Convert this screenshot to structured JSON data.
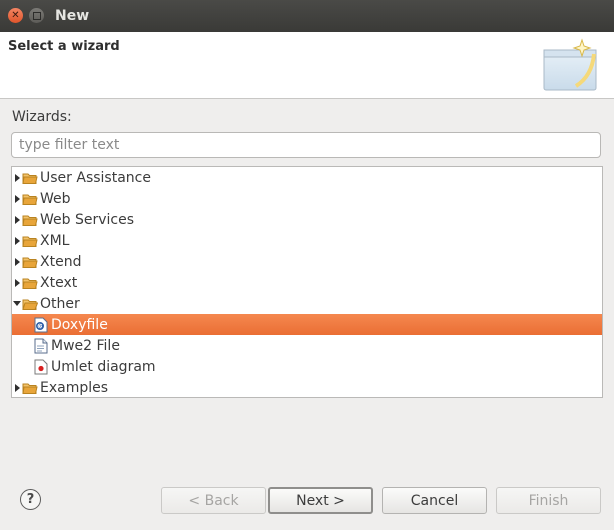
{
  "window": {
    "title": "New"
  },
  "header": {
    "title": "Select a wizard"
  },
  "wizards_label": "Wizards:",
  "filter": {
    "placeholder": "type filter text",
    "value": ""
  },
  "tree": [
    {
      "label": "User Assistance",
      "type": "folder",
      "expanded": false
    },
    {
      "label": "Web",
      "type": "folder",
      "expanded": false
    },
    {
      "label": "Web Services",
      "type": "folder",
      "expanded": false
    },
    {
      "label": "XML",
      "type": "folder",
      "expanded": false
    },
    {
      "label": "Xtend",
      "type": "folder",
      "expanded": false
    },
    {
      "label": "Xtext",
      "type": "folder",
      "expanded": false
    },
    {
      "label": "Other",
      "type": "folder",
      "expanded": true
    },
    {
      "label": "Doxyfile",
      "type": "doxyfile-icon",
      "child": true,
      "selected": true
    },
    {
      "label": "Mwe2 File",
      "type": "file-icon",
      "child": true
    },
    {
      "label": "Umlet diagram",
      "type": "umlet-icon",
      "child": true
    },
    {
      "label": "Examples",
      "type": "folder",
      "expanded": false
    }
  ],
  "buttons": {
    "back": "< Back",
    "next": "Next >",
    "cancel": "Cancel",
    "finish": "Finish"
  },
  "colors": {
    "selection": "#ea6e34",
    "folder": "#e8a53a",
    "titlebar": "#3c3b37"
  }
}
